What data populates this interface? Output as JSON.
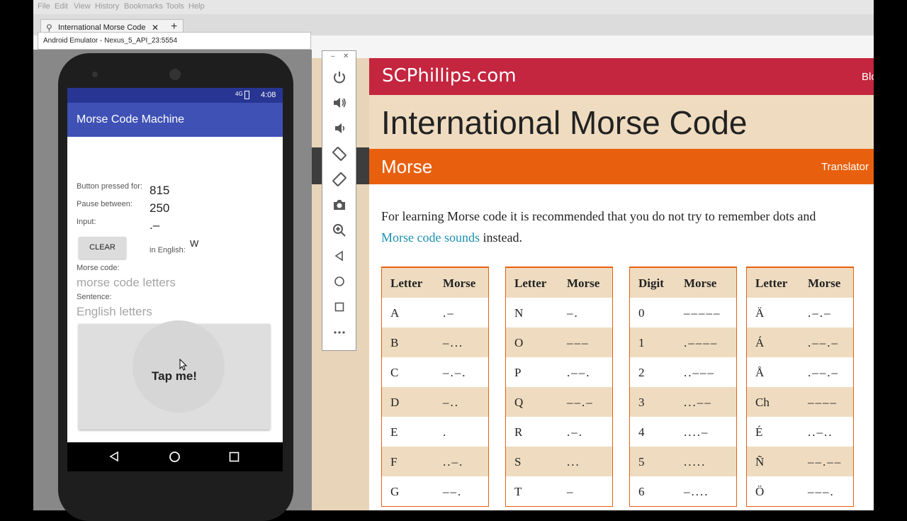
{
  "firefox": {
    "menu": [
      "File",
      "Edit",
      "View",
      "History",
      "Bookmarks",
      "Tools",
      "Help"
    ],
    "tab_title": "International Morse Code",
    "tab_close": "✕",
    "new_tab": "+"
  },
  "emulator": {
    "window_title": "Android Emulator - Nexus_5_API_23:5554",
    "toolbar": [
      "power-icon",
      "volume-up-icon",
      "volume-down-icon",
      "rotate-left-icon",
      "rotate-right-icon",
      "camera-icon",
      "zoom-icon",
      "back-icon",
      "home-icon",
      "overview-icon",
      "more-icon"
    ]
  },
  "app": {
    "status_time": "4:08",
    "status_network": "4G",
    "title": "Morse Code Machine",
    "pressed_label": "Button pressed for:",
    "pressed_value": "815",
    "pause_label": "Pause between:",
    "pause_value": "250",
    "input_label": "Input:",
    "input_value": ".–",
    "clear_label": "CLEAR",
    "english_label": "in English:",
    "english_value": "W",
    "morse_label": "Morse code:",
    "morse_hint": "morse code letters",
    "sentence_label": "Sentence:",
    "sentence_hint": "English letters",
    "tap_label": "Tap me!"
  },
  "site": {
    "brand": "SCPhillips.com",
    "nav_blog": "Blo",
    "page_title": "International Morse Code",
    "section_title": "Morse",
    "nav_translator": "Translator",
    "intro_text": "For learning Morse code it is recommended that you do not try to remember dots and",
    "intro_link": "Morse code sounds",
    "intro_tail": " instead.",
    "tables": [
      {
        "h1": "Letter",
        "h2": "Morse",
        "rows": [
          [
            "A",
            ".–"
          ],
          [
            "B",
            "–..."
          ],
          [
            "C",
            "–.–."
          ],
          [
            "D",
            "–.."
          ],
          [
            "E",
            "."
          ],
          [
            "F",
            "..–."
          ],
          [
            "G",
            "––."
          ]
        ]
      },
      {
        "h1": "Letter",
        "h2": "Morse",
        "rows": [
          [
            "N",
            "–."
          ],
          [
            "O",
            "–––"
          ],
          [
            "P",
            ".––."
          ],
          [
            "Q",
            "––.–"
          ],
          [
            "R",
            ".–."
          ],
          [
            "S",
            "..."
          ],
          [
            "T",
            "–"
          ]
        ]
      },
      {
        "h1": "Digit",
        "h2": "Morse",
        "rows": [
          [
            "0",
            "–––––"
          ],
          [
            "1",
            ".––––"
          ],
          [
            "2",
            "..–––"
          ],
          [
            "3",
            "...––"
          ],
          [
            "4",
            "....–"
          ],
          [
            "5",
            "....."
          ],
          [
            "6",
            "–...."
          ]
        ]
      },
      {
        "h1": "Letter",
        "h2": "Morse",
        "rows": [
          [
            "Ä",
            ".–.–"
          ],
          [
            "Á",
            ".––.–"
          ],
          [
            "Å",
            ".––.–"
          ],
          [
            "Ch",
            "––––"
          ],
          [
            "É",
            "..–.."
          ],
          [
            "Ñ",
            "––.––"
          ],
          [
            "Ö",
            "–––."
          ]
        ]
      }
    ]
  }
}
